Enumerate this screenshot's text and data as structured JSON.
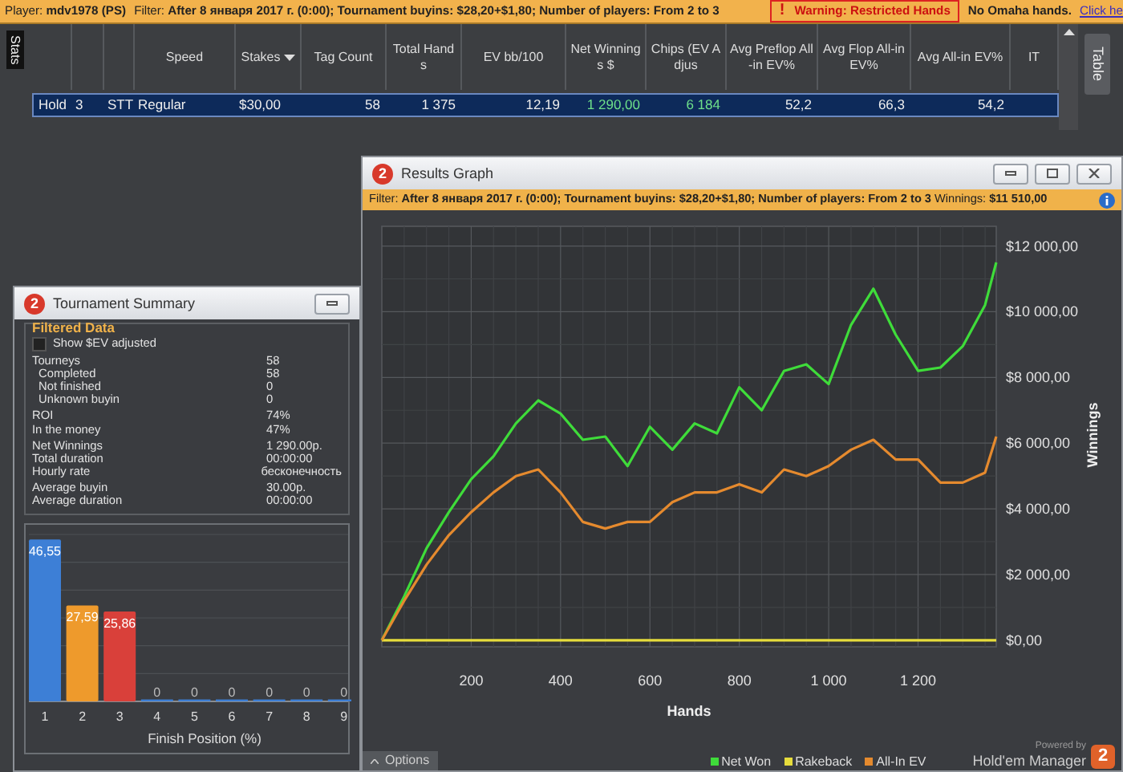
{
  "top_bar": {
    "player": "Player: **mdv1978 (PS)**",
    "filter": "Filter: **After 8 января 2017 г. (0:00); Tournament buyins: $28,20+$1,80; Number of players: From 2 to 3**",
    "warning_mark": "!",
    "warning": "Warning: Restricted Hands",
    "note": "No Omaha hands.",
    "link": "Click he"
  },
  "side_tabs": {
    "left": "Stats",
    "right": "Table"
  },
  "table": {
    "columns": [
      {
        "sorted": false
      },
      {
        "sorted": false
      },
      {
        "sorted": false
      },
      {
        "label": "Speed",
        "sorted": false
      },
      {
        "label": "Stakes",
        "sorted": true
      },
      {
        "label": "Tag Count",
        "sorted": false
      },
      {
        "label": "Total Hands",
        "sorted": false
      },
      {
        "label": "EV bb/100",
        "sorted": false
      },
      {
        "label": "Net Winnings $",
        "sorted": false
      },
      {
        "label": "Chips (EV Adjus",
        "sorted": false
      },
      {
        "label": "Avg Preflop All-in EV%",
        "sorted": false
      },
      {
        "label": "Avg Flop All-in EV%",
        "sorted": false
      },
      {
        "label": "Avg All-in EV%",
        "sorted": false
      },
      {
        "label": "IT",
        "sorted": false
      }
    ],
    "rows": [
      {
        "selected": true,
        "cells": [
          {
            "text": "Hold",
            "kind": "text"
          },
          {
            "text": "3",
            "kind": "text"
          },
          {
            "text": "STT",
            "kind": "text"
          },
          {
            "text": "Regular",
            "kind": "text"
          },
          {
            "text": "$30,00",
            "kind": "text"
          },
          {
            "text": "58",
            "kind": "number"
          },
          {
            "text": "1 375",
            "kind": "number"
          },
          {
            "text": "12,19",
            "kind": "number"
          },
          {
            "text": "1 290,00",
            "kind": "gain"
          },
          {
            "text": "6 184",
            "kind": "gain"
          },
          {
            "text": "52,2",
            "kind": "number"
          },
          {
            "text": "66,3",
            "kind": "number"
          },
          {
            "text": "54,2",
            "kind": "number"
          }
        ]
      }
    ]
  },
  "summary": {
    "logo": "2",
    "title": "Tournament Summary",
    "section": "Filtered Data",
    "option": {
      "label": "Show $EV adjusted",
      "checked": false
    },
    "groups": [
      [
        {
          "label": "Tourneys",
          "value": "58",
          "children": [
            {
              "label": "Completed",
              "value": "58"
            },
            {
              "label": "Not finished",
              "value": "0"
            },
            {
              "label": "Unknown buyin",
              "value": "0"
            }
          ]
        }
      ],
      [
        {
          "label": "ROI",
          "value": "74%"
        },
        {
          "label": "In the money",
          "value": "47%"
        }
      ],
      [
        {
          "label": "Net Winnings",
          "value": "1 290.00р."
        },
        {
          "label": "Total duration",
          "value": "00:00:00"
        },
        {
          "label": "Hourly rate",
          "value": "бесконечность"
        }
      ],
      [
        {
          "label": "Average buyin",
          "value": "30.00р."
        },
        {
          "label": "Average duration",
          "value": "00:00:00"
        }
      ]
    ],
    "chart_data": {
      "type": "bar",
      "xlabel": "Finish Position (%)",
      "categories": [
        "1",
        "2",
        "3",
        "4",
        "5",
        "6",
        "7",
        "8",
        "9"
      ],
      "values": [
        46.55,
        27.59,
        25.86,
        0,
        0,
        0,
        0,
        0,
        0
      ],
      "colors": [
        "#3d7fd6",
        "#ee9a2c",
        "#d9403a",
        "#3d7fd6",
        "#3d7fd6",
        "#3d7fd6",
        "#3d7fd6",
        "#3d7fd6",
        "#3d7fd6"
      ],
      "value_labels": [
        "46,55",
        "27,59",
        "25,86",
        "0",
        "0",
        "0",
        "0",
        "0",
        "0"
      ],
      "ylim": [
        0,
        48
      ]
    }
  },
  "graph": {
    "logo": "2",
    "title": "Results Graph",
    "filter": "Filter: **After 8 января 2017 г. (0:00); Tournament buyins: $28,20+$1,80; Number of players: From 2 to 3** Winnings: **$11 510,00**",
    "chart_data": {
      "type": "line",
      "xlabel": "Hands",
      "ylabel": "Winnings",
      "x": [
        0,
        50,
        100,
        150,
        200,
        250,
        300,
        350,
        400,
        450,
        500,
        550,
        600,
        650,
        700,
        750,
        800,
        850,
        900,
        950,
        1000,
        1050,
        1100,
        1150,
        1200,
        1250,
        1300,
        1350,
        1375
      ],
      "series": [
        {
          "name": "Net Won",
          "color": "#3fdc3a",
          "values": [
            0,
            1330,
            2800,
            3900,
            4900,
            5600,
            6600,
            7300,
            6900,
            6100,
            6200,
            5300,
            6500,
            5800,
            6600,
            6300,
            7700,
            7000,
            8200,
            8400,
            7800,
            9600,
            10700,
            9300,
            8200,
            8300,
            8950,
            10200,
            11500
          ]
        },
        {
          "name": "Rakeback",
          "color": "#e6dc3c",
          "values": [
            0,
            0,
            0,
            0,
            0,
            0,
            0,
            0,
            0,
            0,
            0,
            0,
            0,
            0,
            0,
            0,
            0,
            0,
            0,
            0,
            0,
            0,
            0,
            0,
            0,
            0,
            0,
            0,
            0
          ]
        },
        {
          "name": "All-In EV",
          "color": "#e58a2e",
          "values": [
            0,
            1200,
            2300,
            3200,
            3900,
            4500,
            5000,
            5200,
            4500,
            3600,
            3400,
            3600,
            3600,
            4200,
            4500,
            4500,
            4750,
            4500,
            5200,
            5000,
            5300,
            5800,
            6100,
            5500,
            5500,
            4800,
            4800,
            5100,
            6200
          ]
        }
      ],
      "xlim": [
        0,
        1375
      ],
      "ylim": [
        -200,
        12600
      ],
      "grid": true,
      "xticks": [
        {
          "value": 200,
          "label": "200"
        },
        {
          "value": 400,
          "label": "400"
        },
        {
          "value": 600,
          "label": "600"
        },
        {
          "value": 800,
          "label": "800"
        },
        {
          "value": 1000,
          "label": "1 000"
        },
        {
          "value": 1200,
          "label": "1 200"
        }
      ],
      "yticks": [
        {
          "value": 0,
          "label": "$0,00"
        },
        {
          "value": 2000,
          "label": "$2 000,00"
        },
        {
          "value": 4000,
          "label": "$4 000,00"
        },
        {
          "value": 6000,
          "label": "$6 000,00"
        },
        {
          "value": 8000,
          "label": "$8 000,00"
        },
        {
          "value": 10000,
          "label": "$10 000,00"
        },
        {
          "value": 12000,
          "label": "$12 000,00"
        }
      ]
    },
    "options_button": "Options",
    "powered_by": "Powered by",
    "brand": "Hold'em Manager",
    "brand_logo": "2"
  }
}
